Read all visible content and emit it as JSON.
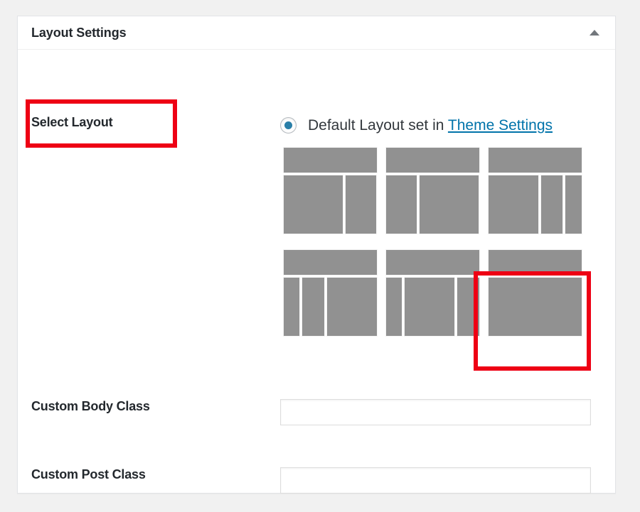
{
  "page": {
    "background_color": "#f1f1f1"
  },
  "panel": {
    "title": "Layout Settings",
    "toggle_icon": "caret-up-icon",
    "toggle_state": "expanded",
    "border_color": "#e2e4e7"
  },
  "select_layout": {
    "label": "Select Layout",
    "annotation_color": "#ee0014",
    "annotated": true,
    "default_option": {
      "radio_checked": true,
      "text_before_link": "Default Layout set in",
      "link_label": "Theme Settings",
      "link_color": "#0073aa"
    },
    "thumbnail_fill_color": "#919191",
    "options": [
      {
        "name": "content-sidebar",
        "has_header_bar": true,
        "columns": [
          64,
          32
        ],
        "selected": false,
        "annotated": false
      },
      {
        "name": "sidebar-content",
        "has_header_bar": true,
        "columns": [
          32,
          64
        ],
        "selected": false,
        "annotated": false
      },
      {
        "name": "content-sidebar-sidebar",
        "has_header_bar": true,
        "columns": [
          56,
          24,
          16
        ],
        "selected": false,
        "annotated": false
      },
      {
        "name": "sidebar-sidebar-content",
        "has_header_bar": true,
        "columns": [
          16,
          24,
          56
        ],
        "selected": false,
        "annotated": false
      },
      {
        "name": "sidebar-content-sidebar",
        "has_header_bar": true,
        "columns": [
          16,
          56,
          24
        ],
        "selected": false,
        "annotated": false
      },
      {
        "name": "full-width-content",
        "has_header_bar": true,
        "columns": [
          100
        ],
        "selected": false,
        "annotated": true
      }
    ]
  },
  "custom_body_class": {
    "label": "Custom Body Class",
    "value": "",
    "placeholder": ""
  },
  "custom_post_class": {
    "label": "Custom Post Class",
    "value": "",
    "placeholder": ""
  }
}
